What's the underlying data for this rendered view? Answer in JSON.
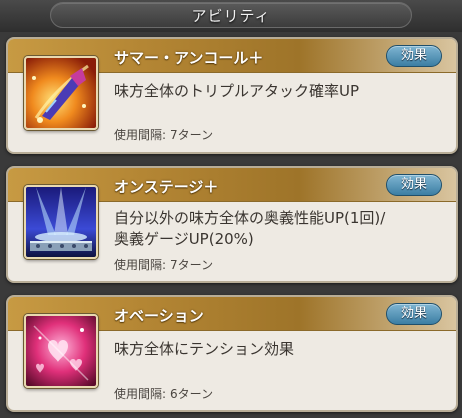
{
  "header": {
    "title": "アビリティ"
  },
  "abilities": [
    {
      "name": "サマー・アンコール＋",
      "effect_label": "効果",
      "description_lines": [
        "味方全体のトリプルアタック確率UP"
      ],
      "cooldown_label": "使用間隔:",
      "cooldown_value": "7ターン",
      "icon": "encore-flame-icon"
    },
    {
      "name": "オンステージ＋",
      "effect_label": "効果",
      "description_lines": [
        "自分以外の味方全体の奥義性能UP(1回)/",
        "奥義ゲージUP(20%)"
      ],
      "cooldown_label": "使用間隔:",
      "cooldown_value": "7ターン",
      "icon": "stage-spotlight-icon"
    },
    {
      "name": "オベーション",
      "effect_label": "効果",
      "description_lines": [
        "味方全体にテンション効果"
      ],
      "cooldown_label": "使用間隔:",
      "cooldown_value": "6ターン",
      "icon": "ovation-hearts-icon"
    }
  ]
}
